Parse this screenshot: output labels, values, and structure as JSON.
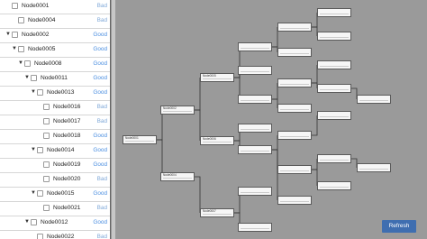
{
  "sidebar": {
    "rows": [
      {
        "label": "Node0001",
        "status": "Bad",
        "toggle": "",
        "indent": 0
      },
      {
        "label": "Node0004",
        "status": "Bad",
        "toggle": "",
        "indent": 1
      },
      {
        "label": "Node0002",
        "status": "Good",
        "toggle": "▼",
        "indent": 0
      },
      {
        "label": "Node0005",
        "status": "Good",
        "toggle": "▼",
        "indent": 1
      },
      {
        "label": "Node0008",
        "status": "Good",
        "toggle": "▼",
        "indent": 2
      },
      {
        "label": "Node0011",
        "status": "Good",
        "toggle": "▼",
        "indent": 3
      },
      {
        "label": "Node0013",
        "status": "Good",
        "toggle": "▼",
        "indent": 4
      },
      {
        "label": "Node0016",
        "status": "Bad",
        "toggle": "",
        "indent": 5
      },
      {
        "label": "Node0017",
        "status": "Bad",
        "toggle": "",
        "indent": 5
      },
      {
        "label": "Node0018",
        "status": "Good",
        "toggle": "",
        "indent": 5
      },
      {
        "label": "Node0014",
        "status": "Good",
        "toggle": "▼",
        "indent": 4
      },
      {
        "label": "Node0019",
        "status": "Good",
        "toggle": "",
        "indent": 5
      },
      {
        "label": "Node0020",
        "status": "Bad",
        "toggle": "",
        "indent": 5
      },
      {
        "label": "Node0015",
        "status": "Good",
        "toggle": "▼",
        "indent": 4
      },
      {
        "label": "Node0021",
        "status": "Bad",
        "toggle": "",
        "indent": 5
      },
      {
        "label": "Node0012",
        "status": "Good",
        "toggle": "▼",
        "indent": 3
      },
      {
        "label": "Node0022",
        "status": "Bad",
        "toggle": "",
        "indent": 4
      }
    ]
  },
  "tree": {
    "nodes": [
      {
        "id": "Node0001",
        "col": 0,
        "row": 0
      },
      {
        "id": "Node0002",
        "col": 0,
        "row": 1
      },
      {
        "id": "Node0004",
        "col": 1,
        "row": 0
      },
      {
        "id": "Node0005",
        "col": 1,
        "row": 1
      },
      {
        "id": "Node0006",
        "col": 1,
        "row": 2
      },
      {
        "id": "Node0007",
        "col": 1,
        "row": 3
      }
    ],
    "edges": [
      [
        "Node0001",
        "Node0004"
      ],
      [
        "Node0002",
        "Node0005"
      ]
    ]
  },
  "toolbar": {
    "refresh_label": "Refresh"
  },
  "colors": {
    "good": "#4a8ee0",
    "bad": "#7fa8d8",
    "canvas": "#9a9a9a",
    "button": "#3f6eb0"
  }
}
